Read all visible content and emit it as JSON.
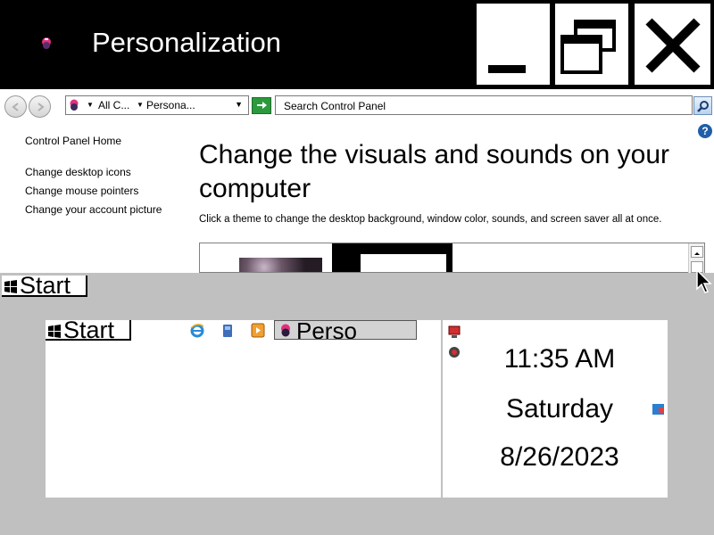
{
  "window": {
    "title": "Personalization",
    "minimize_icon": "minimize-icon",
    "maximize_icon": "restore-icon",
    "close_icon": "close-icon"
  },
  "address_bar": {
    "breadcrumb": [
      "All C...",
      "Persona..."
    ],
    "search_placeholder": "Search Control Panel"
  },
  "sidebar": {
    "home_link": "Control Panel Home",
    "links": [
      "Change desktop icons",
      "Change mouse pointers",
      "Change your account picture"
    ]
  },
  "main": {
    "heading": "Change the visuals and sounds on your computer",
    "description": "Click a theme to change the desktop background, window color, sounds, and screen saver all at once.",
    "help": "?"
  },
  "taskbar": {
    "start_label": "Start",
    "start_label_2": "Start",
    "quick_launch": [
      "ie-icon",
      "media-folder-icon",
      "media-player-icon"
    ],
    "active_task_label": "Perso",
    "clock": {
      "time": "11:35 AM",
      "day": "Saturday",
      "date": "8/26/2023"
    }
  },
  "colors": {
    "titlebar": "#000000",
    "taskbar": "#c0c0c0",
    "refresh": "#2b9a3c",
    "help": "#1f5fa8"
  }
}
